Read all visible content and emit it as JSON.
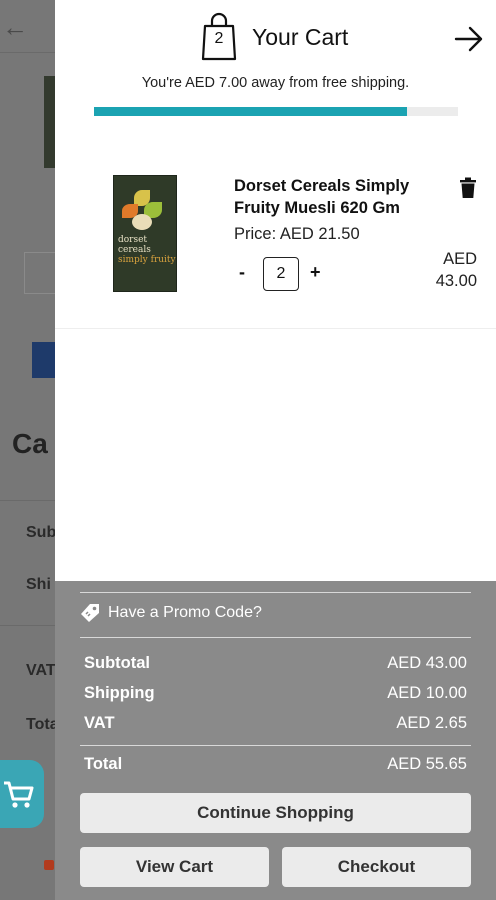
{
  "header": {
    "cart_count": "2",
    "title": "Your Cart"
  },
  "shipping": {
    "message": "You're AED 7.00 away from free shipping.",
    "progress_fraction": 0.86
  },
  "item": {
    "name": "Dorset Cereals Simply Fruity Muesli 620 Gm",
    "price": "Price: AED 21.50",
    "minus_label": "-",
    "quantity": "2",
    "plus_label": "+",
    "line_total_currency": "AED",
    "line_total_amount": "43.00",
    "image_brand_text": [
      "dorset",
      "cereals",
      "simply fruity"
    ]
  },
  "summary": {
    "promo_label": "Have a Promo Code?",
    "rows": [
      {
        "label": "Subtotal",
        "value": "AED 43.00"
      },
      {
        "label": "Shipping",
        "value": "AED 10.00"
      },
      {
        "label": "VAT",
        "value": "AED 2.65"
      },
      {
        "label": "Total",
        "value": "AED 55.65"
      }
    ]
  },
  "buttons": {
    "continue": "Continue Shopping",
    "view_cart": "View Cart",
    "checkout": "Checkout"
  },
  "colors": {
    "accent": "#1ba3b2",
    "overlay": "#8a8a8a",
    "button_bg": "#ebebeb"
  }
}
